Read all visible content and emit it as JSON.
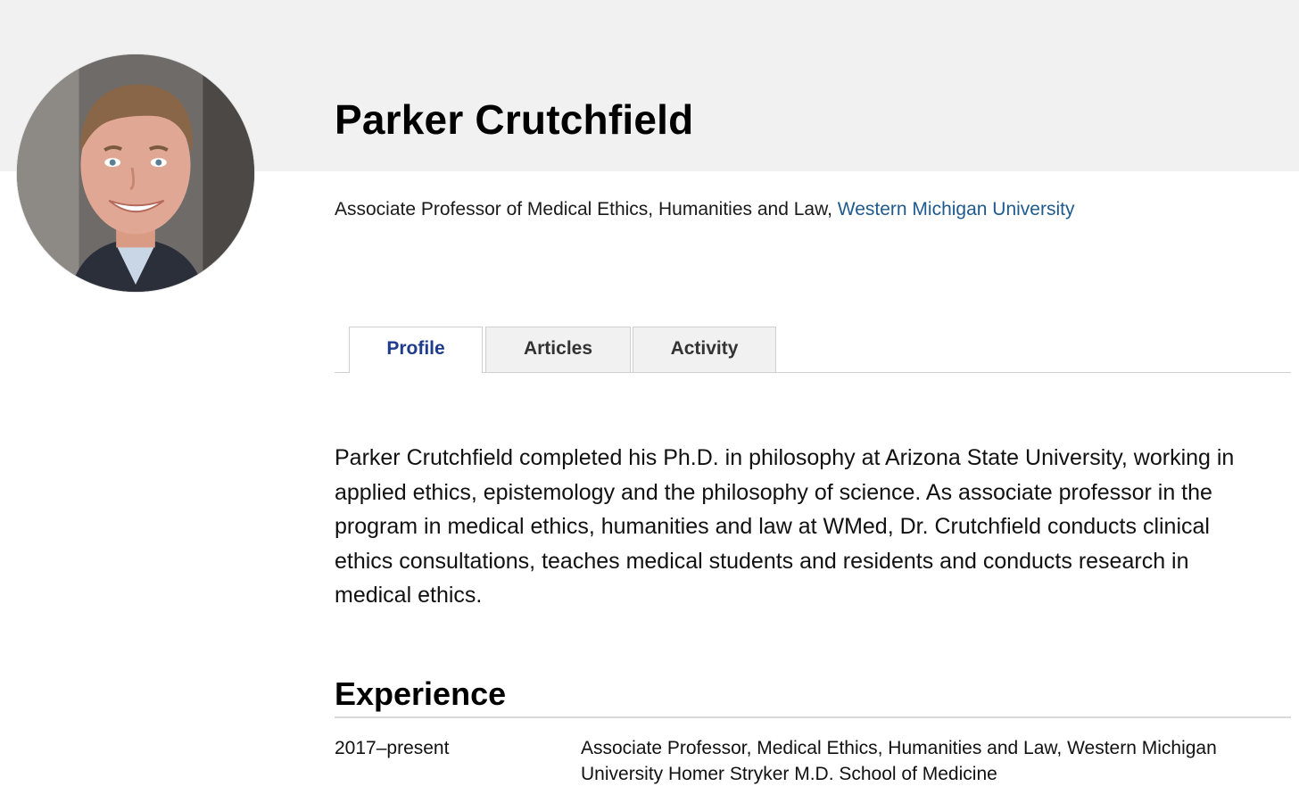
{
  "profile": {
    "name": "Parker Crutchfield",
    "role_prefix": "Associate Professor of Medical Ethics, Humanities and Law, ",
    "institution": "Western Michigan University",
    "avatar_alt": "Parker Crutchfield"
  },
  "tabs": [
    {
      "label": "Profile",
      "active": true
    },
    {
      "label": "Articles",
      "active": false
    },
    {
      "label": "Activity",
      "active": false
    }
  ],
  "bio": "Parker Crutchfield completed his Ph.D. in philosophy at Arizona State University, working in applied ethics, epistemology and the philosophy of science. As associate professor in the program in medical ethics, humanities and law at WMed, Dr. Crutchfield conducts clinical ethics consultations, teaches medical students and residents and conducts research in medical ethics.",
  "experience": {
    "title": "Experience",
    "items": [
      {
        "dates": "2017–present",
        "description": "Associate Professor, Medical Ethics, Humanities and Law, Western Michigan University Homer Stryker M.D. School of Medicine"
      }
    ]
  },
  "colors": {
    "header_band": "#f1f1f1",
    "link": "#1e5a8e",
    "active_tab": "#1f3c8c"
  }
}
